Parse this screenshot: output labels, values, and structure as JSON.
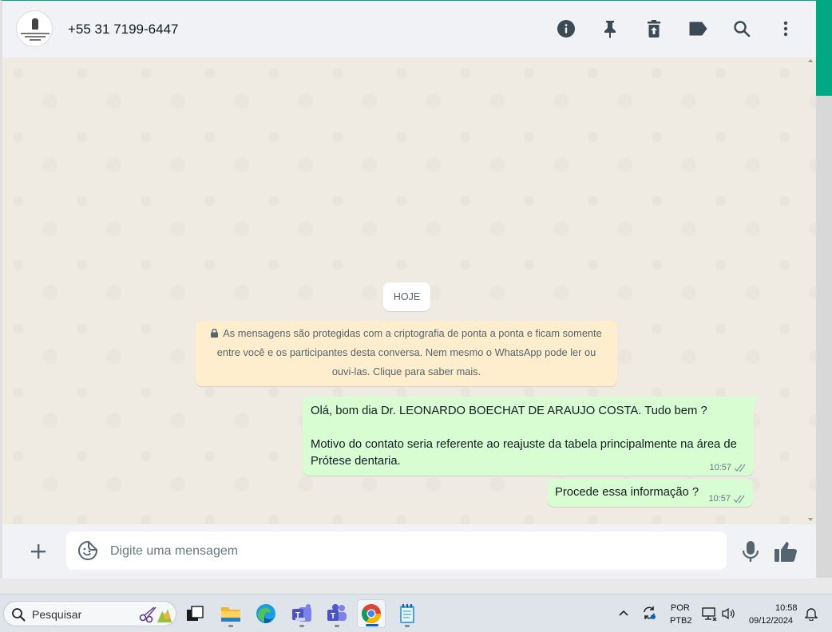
{
  "chat_header": {
    "contact_name": "+55 31 7199-6447",
    "icons": [
      "info-icon",
      "pin-icon",
      "delete-icon",
      "label-icon",
      "search-icon",
      "more-vertical-icon"
    ]
  },
  "chat": {
    "date_separator": "HOJE",
    "encryption_notice": "As mensagens são protegidas com a criptografia de ponta a ponta e ficam somente entre você e os participantes desta conversa. Nem mesmo o WhatsApp pode ler ou ouvi-las. Clique para saber mais.",
    "messages": [
      {
        "line1": "Olá, bom dia Dr.  LEONARDO BOECHAT DE ARAUJO COSTA. Tudo bem ?",
        "line2": "Motivo do contato seria referente ao reajuste da tabela principalmente na área de Prótese dentaria.",
        "time": "10:57",
        "status": "delivered"
      },
      {
        "line1": "Procede essa informação ?",
        "time": "10:57",
        "status": "delivered"
      }
    ]
  },
  "composer": {
    "placeholder": "Digite uma mensagem"
  },
  "taskbar": {
    "search_label": "Pesquisar",
    "apps": [
      "task-view",
      "file-explorer",
      "edge",
      "teams-classic",
      "teams",
      "chrome",
      "notepad"
    ],
    "active_app": "chrome",
    "tray": {
      "lang_line1": "POR",
      "lang_line2": "PTB2",
      "time": "10:58",
      "date": "09/12/2024"
    }
  },
  "colors": {
    "accent": "#00a884",
    "outgoing_bubble": "#d9fdd3",
    "notice_bg": "#ffeecd",
    "chat_bg": "#efeae2",
    "header_bg": "#f0f2f5"
  }
}
